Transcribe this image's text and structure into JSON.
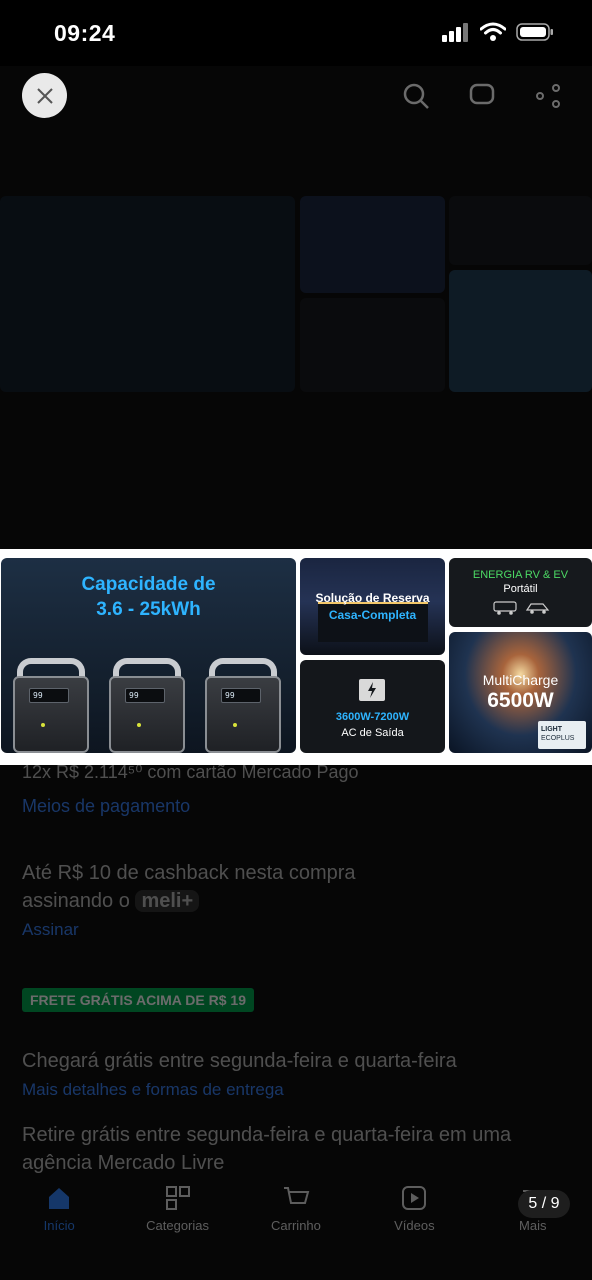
{
  "status_bar": {
    "time": "09:24"
  },
  "image": {
    "main_title_line1": "Capacidade de",
    "main_title_line2": "3.6 - 25kWh",
    "station_screen": "99",
    "house_title": "Solução de Reserva",
    "house_subtitle": "Casa-Completa",
    "rv_title": "ENERGIA RV & EV",
    "rv_subtitle": "Portátil",
    "ac_range": "3600W-7200W",
    "ac_label": "AC de Saída",
    "multi_title": "MultiCharge",
    "multi_value": "6500W",
    "watermark_line1": "LIGHT",
    "watermark_line2": "ECOPLUS"
  },
  "viewer": {
    "page_counter": "5 / 9"
  },
  "background_page": {
    "installments": "12x R$ 2.114⁵⁰ com cartão Mercado Pago",
    "payment_methods": "Meios de pagamento",
    "cashback": "Até R$ 10 de cashback nesta compra",
    "cashback_2": "assinando o",
    "meli_badge": "meli+",
    "subscribe": "Assinar",
    "free_shipping_badge": "FRETE GRÁTIS ACIMA DE R$ 19",
    "delivery": "Chegará grátis entre segunda-feira e quarta-feira",
    "delivery_details": "Mais detalhes e formas de entrega",
    "pickup": "Retire grátis entre segunda-feira e quarta-feira em uma",
    "pickup_2": "agência Mercado Livre",
    "nav": {
      "home": "Início",
      "categories": "Categorias",
      "cart": "Carrinho",
      "videos": "Vídeos",
      "more": "Mais"
    }
  },
  "colors": {
    "accent_blue": "#2eb4ff",
    "green": "#00a650",
    "viewer_bg": "#000000"
  }
}
